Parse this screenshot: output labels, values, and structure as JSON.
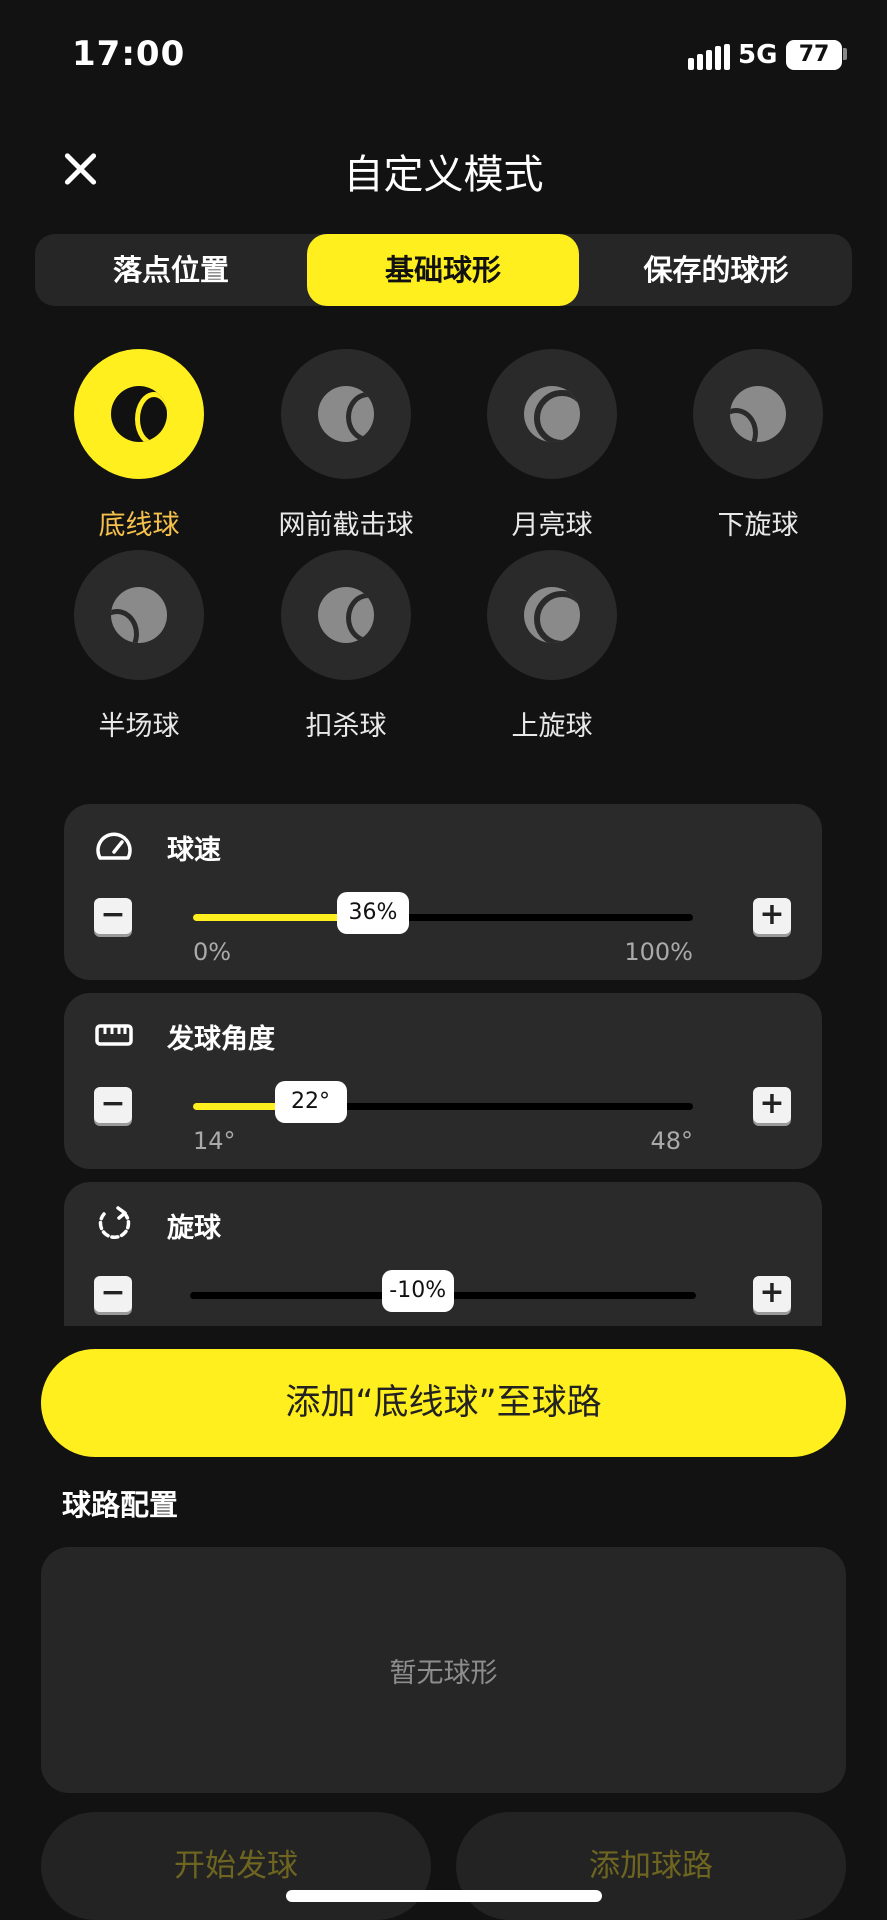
{
  "status_bar": {
    "time": "17:00",
    "network": "5G",
    "battery": "77"
  },
  "header": {
    "title": "自定义模式"
  },
  "tabs": [
    {
      "label": "落点位置",
      "active": false
    },
    {
      "label": "基础球形",
      "active": true
    },
    {
      "label": "保存的球形",
      "active": false
    }
  ],
  "shots": [
    {
      "label": "底线球",
      "active": true
    },
    {
      "label": "网前截击球",
      "active": false
    },
    {
      "label": "月亮球",
      "active": false
    },
    {
      "label": "下旋球",
      "active": false
    },
    {
      "label": "半场球",
      "active": false
    },
    {
      "label": "扣杀球",
      "active": false
    },
    {
      "label": "上旋球",
      "active": false
    }
  ],
  "params": {
    "speed": {
      "title": "球速",
      "value": "36%",
      "fraction": 0.36,
      "min": "0%",
      "max": "100%"
    },
    "angle": {
      "title": "发球角度",
      "value": "22°",
      "fraction": 0.235,
      "min": "14°",
      "max": "48°"
    },
    "spin": {
      "title": "旋球",
      "value": "-10%",
      "fraction": 0.45
    }
  },
  "add_button_label": "添加“底线球”至球路",
  "route_config": {
    "label": "球路配置",
    "empty_text": "暂无球形"
  },
  "bottom_buttons": {
    "start": "开始发球",
    "add_route": "添加球路"
  },
  "colors": {
    "accent": "#ffef1e",
    "background": "#121212",
    "card": "#2a2a2a",
    "active_label": "#f6c14b"
  }
}
